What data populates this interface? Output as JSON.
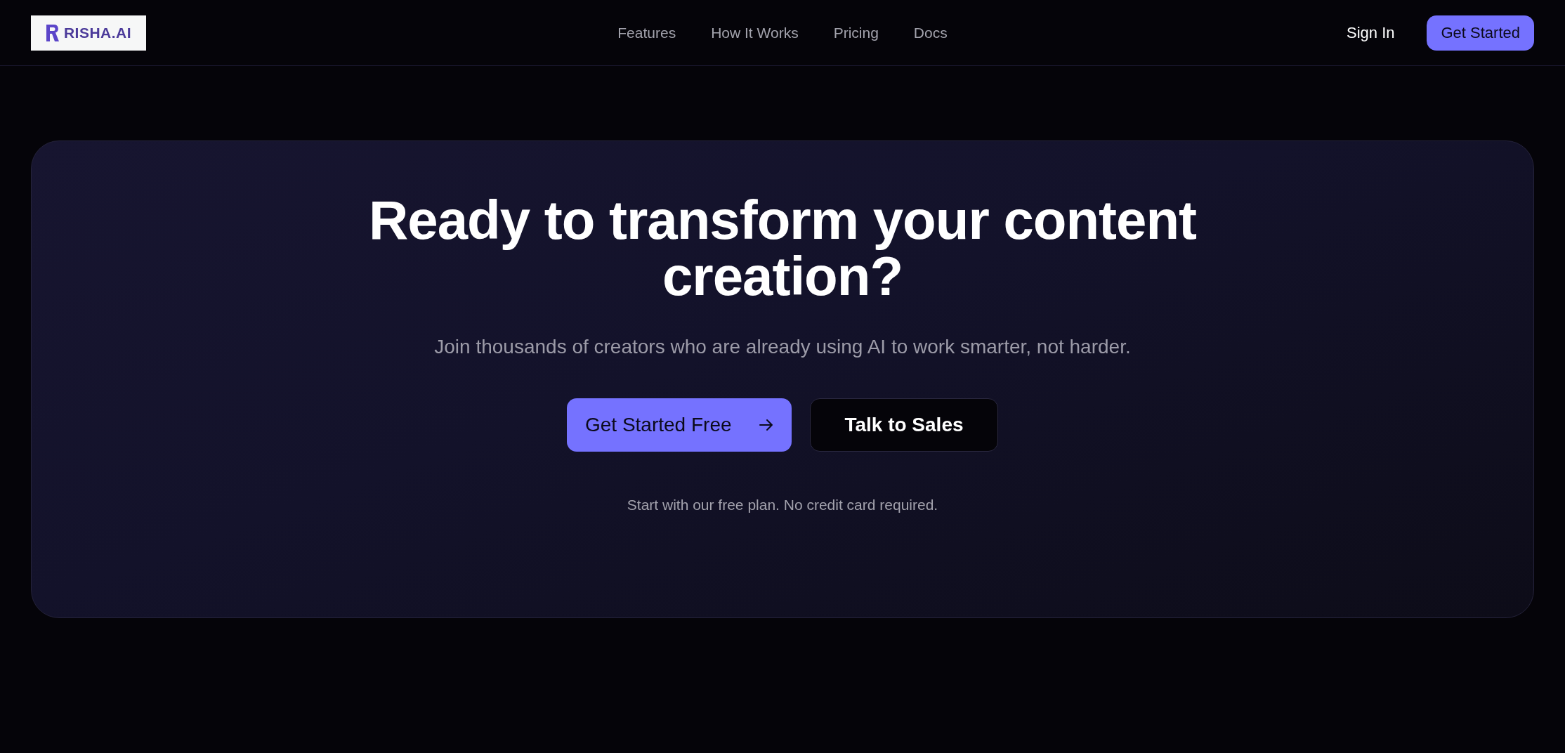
{
  "navbar": {
    "logo": {
      "text": "RISHA.AI"
    },
    "links": [
      {
        "label": "Features"
      },
      {
        "label": "How It Works"
      },
      {
        "label": "Pricing"
      },
      {
        "label": "Docs"
      }
    ],
    "sign_in": "Sign In",
    "get_started": "Get Started"
  },
  "hero": {
    "title": "Ready to transform your content creation?",
    "subtitle": "Join thousands of creators who are already using AI to work smarter, not harder.",
    "buttons": [
      {
        "label": "Get Started Free",
        "kind": "primary"
      },
      {
        "label": "Talk to Sales",
        "kind": "dark"
      }
    ],
    "note": "Start with our free plan. No credit card required."
  }
}
